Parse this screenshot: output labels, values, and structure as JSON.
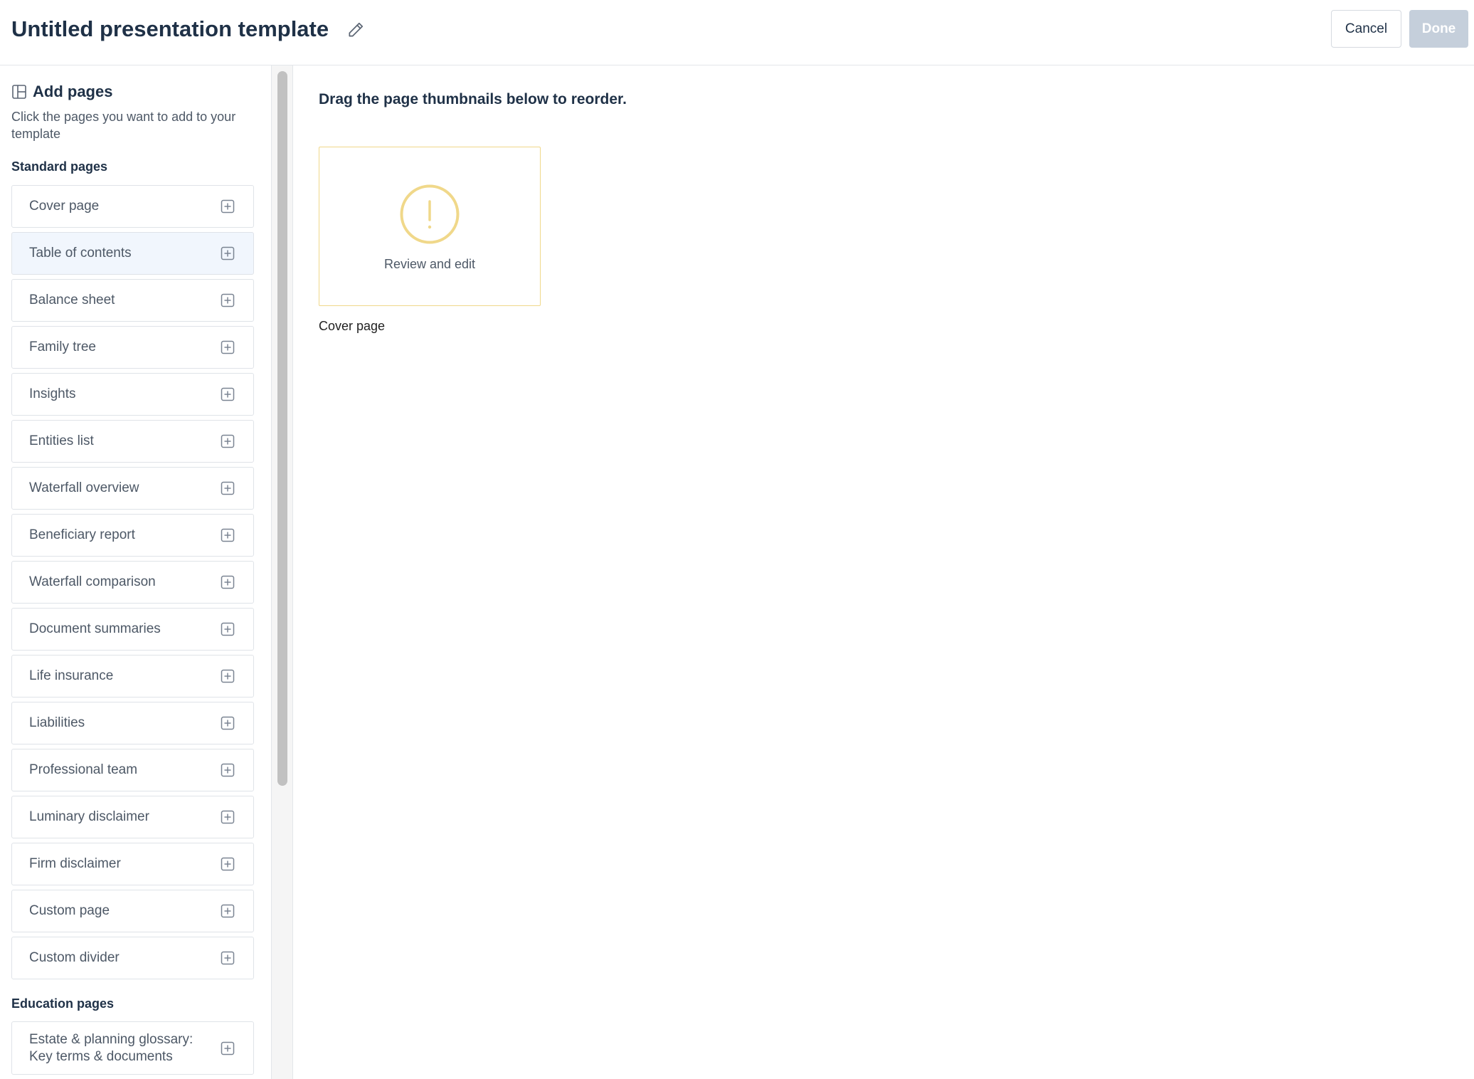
{
  "header": {
    "title": "Untitled presentation template",
    "cancel_label": "Cancel",
    "done_label": "Done"
  },
  "sidebar": {
    "title": "Add pages",
    "description": "Click the pages you want to add to your template",
    "standard_heading": "Standard pages",
    "standard_pages": [
      {
        "label": "Cover page"
      },
      {
        "label": "Table of contents"
      },
      {
        "label": "Balance sheet"
      },
      {
        "label": "Family tree"
      },
      {
        "label": "Insights"
      },
      {
        "label": "Entities list"
      },
      {
        "label": "Waterfall overview"
      },
      {
        "label": "Beneficiary report"
      },
      {
        "label": "Waterfall comparison"
      },
      {
        "label": "Document summaries"
      },
      {
        "label": "Life insurance"
      },
      {
        "label": "Liabilities"
      },
      {
        "label": "Professional team"
      },
      {
        "label": "Luminary disclaimer"
      },
      {
        "label": "Firm disclaimer"
      },
      {
        "label": "Custom page"
      },
      {
        "label": "Custom divider"
      }
    ],
    "education_heading": "Education pages",
    "education_pages": [
      {
        "label": "Estate & planning glossary: Key terms & documents"
      }
    ]
  },
  "main": {
    "instruction": "Drag the page thumbnails below to reorder.",
    "thumbnails": [
      {
        "status_text": "Review and edit",
        "caption": "Cover page"
      }
    ]
  },
  "colors": {
    "text_primary": "#1f3147",
    "text_secondary": "#4d5866",
    "warning": "#f0d88a",
    "done_disabled": "#c5cfdb",
    "row_highlight": "#f1f6fd"
  },
  "icons": {
    "edit": "pencil-icon",
    "add_pages": "layout-icon",
    "add_item": "plus-square-icon",
    "warning": "exclamation-circle-icon"
  }
}
